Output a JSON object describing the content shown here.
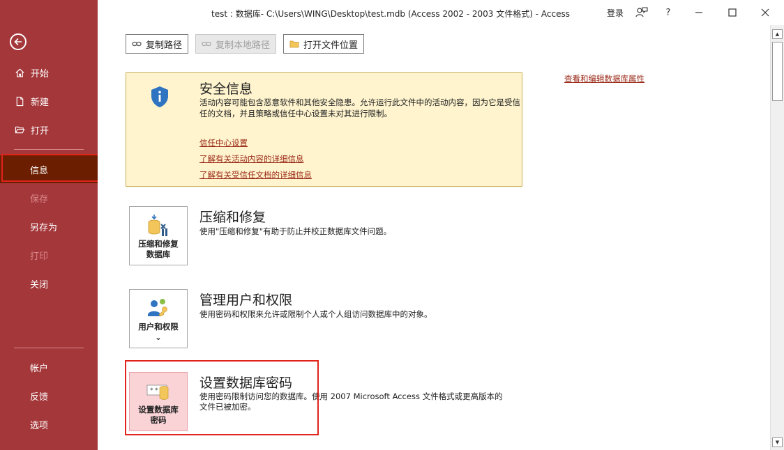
{
  "window": {
    "title": "test : 数据库- C:\\Users\\WING\\Desktop\\test.mdb (Access 2002 - 2003 文件格式)  -  Access",
    "signin": "登录",
    "help": "?"
  },
  "sidebar": {
    "items": [
      {
        "label": "开始",
        "icon": "home-icon"
      },
      {
        "label": "新建",
        "icon": "new-document-icon"
      },
      {
        "label": "打开",
        "icon": "open-folder-icon"
      },
      {
        "label": "信息",
        "state": "selected"
      },
      {
        "label": "保存",
        "state": "disabled"
      },
      {
        "label": "另存为"
      },
      {
        "label": "打印",
        "state": "disabled"
      },
      {
        "label": "关闭"
      },
      {
        "label": "帐户"
      },
      {
        "label": "反馈"
      },
      {
        "label": "选项"
      }
    ]
  },
  "toolbar": {
    "copy_path": "复制路径",
    "copy_local_path": "复制本地路径",
    "open_file_location": "打开文件位置"
  },
  "security": {
    "title": "安全信息",
    "description": "活动内容可能包含恶意软件和其他安全隐患。允许运行此文件中的活动内容，因为它是受信任的文档，并且策略或信任中心设置未对其进行限制。",
    "links": [
      "信任中心设置",
      "了解有关活动内容的详细信息",
      "了解有关受信任文档的详细信息"
    ]
  },
  "properties_link": "查看和编辑数据库属性",
  "sections": [
    {
      "tile_label": "压缩和修复数据库",
      "tile_line1": "压缩和修复",
      "tile_line2": "数据库",
      "title": "压缩和修复",
      "description": "使用\"压缩和修复\"有助于防止并校正数据库文件问题。"
    },
    {
      "tile_line1": "用户和权限",
      "tile_line2": "⌄",
      "title": "管理用户和权限",
      "description": "使用密码和权限来允许或限制个人或个人组访问数据库中的对象。"
    },
    {
      "tile_line1": "设置数据库",
      "tile_line2": "密码",
      "title": "设置数据库密码",
      "description_line1": "使用密码限制访问您的数据库。使用 2007 Microsoft Access 文件格式或更高版本的",
      "description_line2": "文件已被加密。"
    }
  ],
  "colors": {
    "sidebar": "#a4373a",
    "selected": "#6b1f00",
    "security_bg": "#fff4ce",
    "link": "#9b2b1a",
    "highlight": "#e0231b"
  }
}
